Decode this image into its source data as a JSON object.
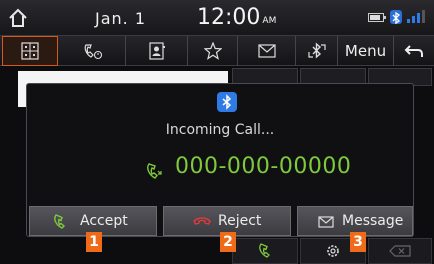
{
  "status_bar": {
    "date": "Jan.  1",
    "time": "12:00",
    "ampm": "AM"
  },
  "toolbar": {
    "items": [
      {
        "icon": "dialpad-icon",
        "active": true
      },
      {
        "icon": "call-history-icon"
      },
      {
        "icon": "contacts-icon"
      },
      {
        "icon": "favorites-icon"
      },
      {
        "icon": "messages-icon"
      },
      {
        "icon": "bluetooth-settings-icon"
      }
    ],
    "menu_label": "Menu",
    "back_icon": "back-icon"
  },
  "popup": {
    "title": "Incoming Call...",
    "caller_number": "000-000-00000",
    "buttons": {
      "accept": "Accept",
      "reject": "Reject",
      "message": "Message"
    }
  },
  "callouts": [
    "1",
    "2",
    "3"
  ],
  "colors": {
    "accent": "#ef6b1a",
    "number": "#7ec93c",
    "reject": "#e03a3a",
    "accept": "#7ec93c"
  }
}
